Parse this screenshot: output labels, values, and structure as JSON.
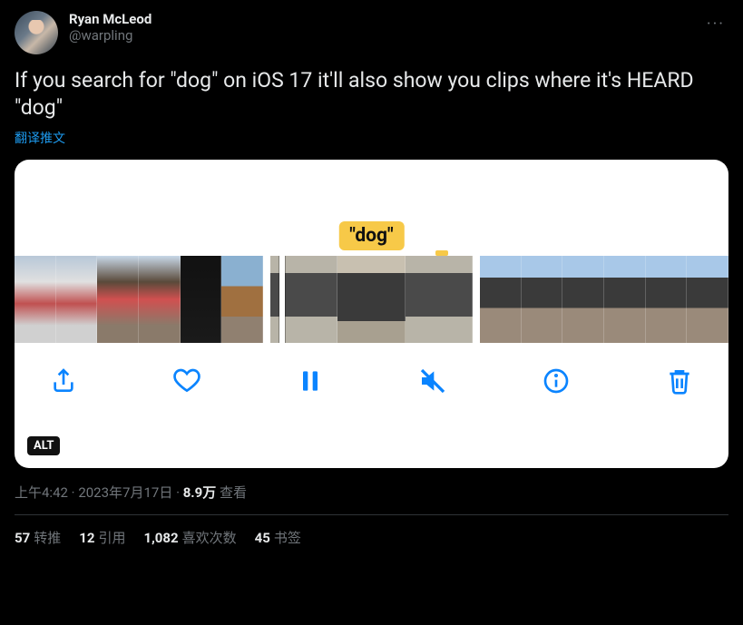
{
  "author": {
    "display_name": "Ryan McLeod",
    "handle": "@warpling"
  },
  "tweet_text": "If you search for \"dog\" on iOS 17 it'll also show you clips where it's HEARD \"dog\"",
  "translate_label": "翻译推文",
  "media": {
    "highlight_label": "\"dog\"",
    "alt_badge": "ALT",
    "icons": {
      "share": "share-icon",
      "like": "heart-icon",
      "pause": "pause-icon",
      "mute": "speaker-muted-icon",
      "info": "info-icon",
      "delete": "trash-icon"
    }
  },
  "meta": {
    "time": "上午4:42",
    "date": "2023年7月17日",
    "views_number": "8.9万",
    "views_label": "查看"
  },
  "stats": {
    "retweets": {
      "count": "57",
      "label": "转推"
    },
    "quotes": {
      "count": "12",
      "label": "引用"
    },
    "likes": {
      "count": "1,082",
      "label": "喜欢次数"
    },
    "bookmarks": {
      "count": "45",
      "label": "书签"
    }
  },
  "more_icon": "···"
}
